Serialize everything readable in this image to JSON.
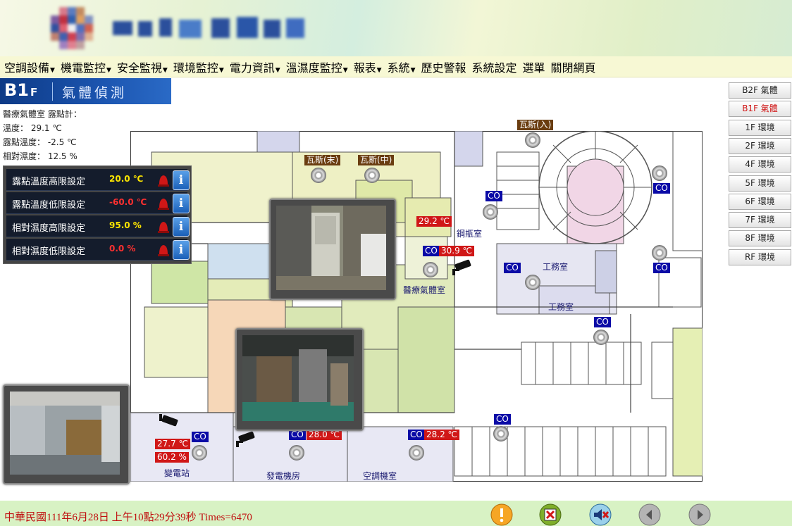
{
  "menu": [
    {
      "label": "空調設備",
      "caret": true
    },
    {
      "label": "機電監控",
      "caret": true
    },
    {
      "label": "安全監視",
      "caret": true
    },
    {
      "label": "環境監控",
      "caret": true
    },
    {
      "label": "電力資訊",
      "caret": true
    },
    {
      "label": "溫濕度監控",
      "caret": true
    },
    {
      "label": "報表",
      "caret": true
    },
    {
      "label": "系統",
      "caret": true
    },
    {
      "label": "歷史警報",
      "caret": false
    },
    {
      "label": "系統設定",
      "caret": false
    },
    {
      "label": "選單",
      "caret": false
    },
    {
      "label": "關閉網頁",
      "caret": false
    }
  ],
  "title": {
    "floor": "B1",
    "floor_suffix": "F",
    "name": "氣體偵測"
  },
  "sensor_info": {
    "header": "醫療氣體室 露點計：",
    "temp_label": "溫度：",
    "temp_value": "29.1 ℃",
    "dew_label": "露點溫度：",
    "dew_value": "-2.5 ℃",
    "rh_label": "相對濕度：",
    "rh_value": "12.5 %"
  },
  "settings": [
    {
      "label": "露點溫度高限設定",
      "value": "20.0 ℃",
      "color": "#ffe600"
    },
    {
      "label": "露點溫度低限設定",
      "value": "-60.0 ℃",
      "color": "#ff3030"
    },
    {
      "label": "相對濕度高限設定",
      "value": "95.0 %",
      "color": "#ffe600"
    },
    {
      "label": "相對濕度低限設定",
      "value": "0.0 %",
      "color": "#ff3030"
    }
  ],
  "tags": {
    "gas_in": "瓦斯(入)",
    "gas_end": "瓦斯(末)",
    "gas_mid": "瓦斯(中)",
    "co": "CO",
    "t_bottle": "29.2 ℃",
    "t_medgas": "30.9 ℃",
    "t_gen": "28.0 ℃",
    "t_ac": "28.2 ℃",
    "t_sub": "27.7 ℃",
    "h_sub": "60.2 %"
  },
  "rooms": {
    "bottle": "鋼瓶室",
    "medgas": "醫療氣體室",
    "work1": "工務室",
    "work2": "工務室",
    "substation": "變電站",
    "generator": "發電機房",
    "ac": "空調機室"
  },
  "floor_buttons": [
    {
      "label": "B2F 氣體",
      "active": false
    },
    {
      "label": "B1F 氣體",
      "active": true
    },
    {
      "label": "1F 環境",
      "active": false
    },
    {
      "label": "2F 環境",
      "active": false
    },
    {
      "label": "4F 環境",
      "active": false
    },
    {
      "label": "5F 環境",
      "active": false
    },
    {
      "label": "6F 環境",
      "active": false
    },
    {
      "label": "7F 環境",
      "active": false
    },
    {
      "label": "8F 環境",
      "active": false
    },
    {
      "label": "RF 環境",
      "active": false
    }
  ],
  "footer": {
    "datetime": "中華民國111年6月28日 上午10點29分39秒 Times=6470"
  },
  "footer_icons": [
    "alarm-icon",
    "stop-icon",
    "mute-icon",
    "prev-icon",
    "next-icon"
  ]
}
